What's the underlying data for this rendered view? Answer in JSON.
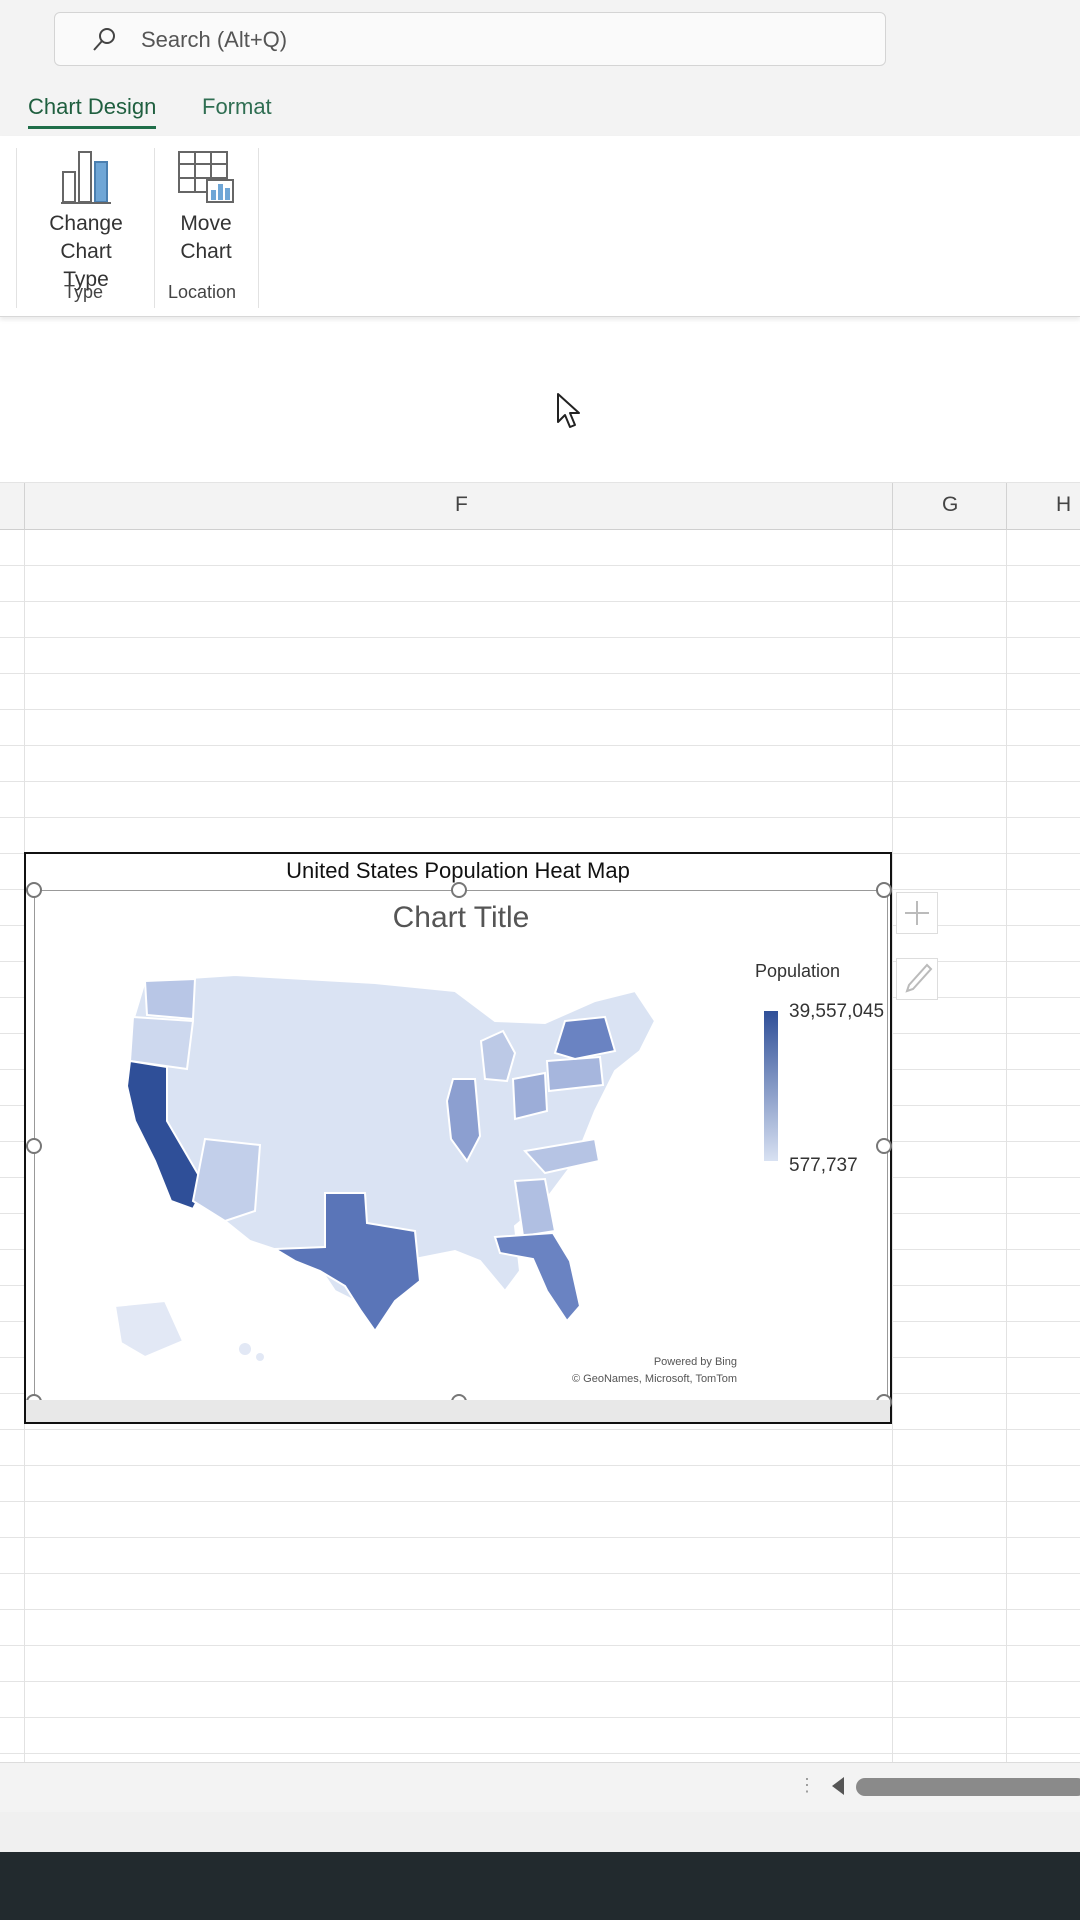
{
  "search": {
    "placeholder": "Search (Alt+Q)"
  },
  "tabs": [
    {
      "label": "Chart Design",
      "active": true
    },
    {
      "label": "Format",
      "active": false
    }
  ],
  "ribbon": {
    "groups": [
      {
        "buttons": [
          {
            "label_line1": "Change",
            "label_line2": "Chart Type",
            "icon": "change-chart-type-icon"
          }
        ],
        "group_label": "Type"
      },
      {
        "buttons": [
          {
            "label_line1": "Move",
            "label_line2": "Chart",
            "icon": "move-chart-icon"
          }
        ],
        "group_label": "Location"
      }
    ]
  },
  "columns": [
    "F",
    "G",
    "H"
  ],
  "chart": {
    "header": "United States Population Heat Map",
    "title": "Chart Title",
    "legend": {
      "title": "Population",
      "max": "39,557,045",
      "min": "577,737"
    },
    "attribution_line1": "Powered by Bing",
    "attribution_line2": "© GeoNames, Microsoft, TomTom"
  },
  "colors": {
    "tab_accent": "#1f6e49",
    "map_dark": "#2f4f98",
    "map_light": "#d8e1f2"
  }
}
